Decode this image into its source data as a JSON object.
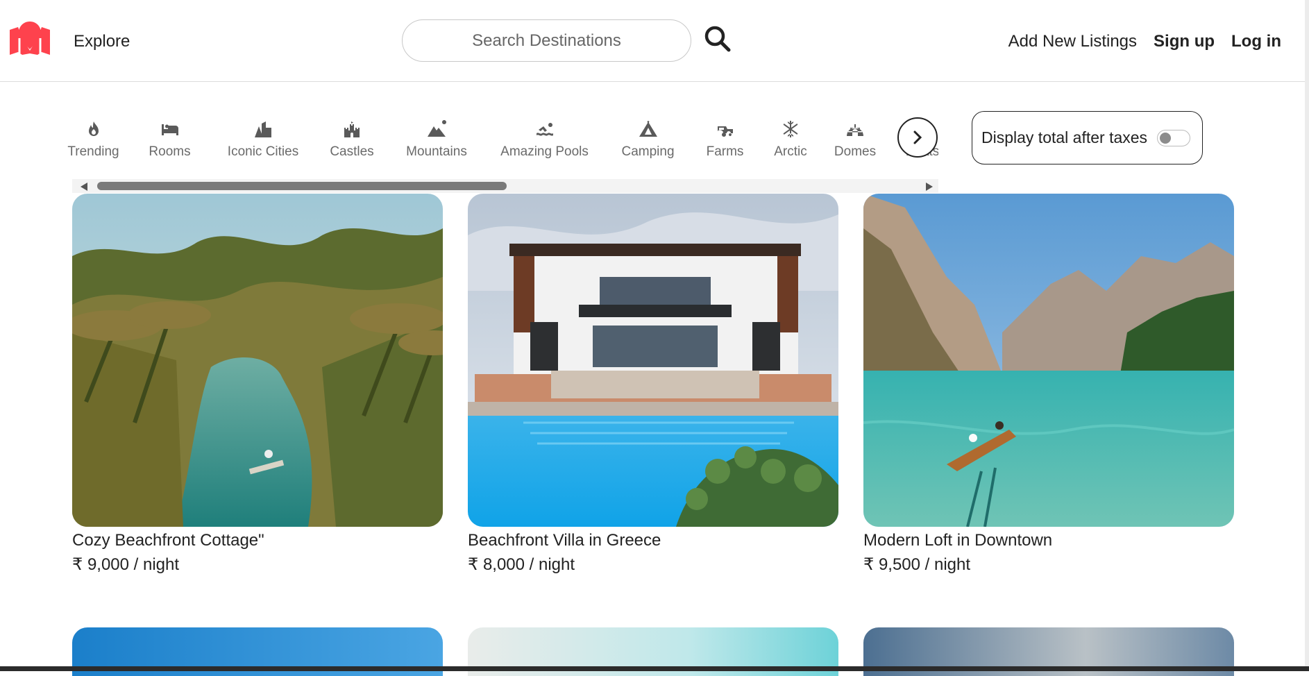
{
  "navbar": {
    "explore_label": "Explore",
    "search_placeholder": "Search Destinations",
    "add_listing_label": "Add New Listings",
    "signup_label": "Sign up",
    "login_label": "Log in",
    "brand_color": "#fe424d"
  },
  "filters": [
    {
      "label": "Trending",
      "icon": "fire-icon"
    },
    {
      "label": "Rooms",
      "icon": "bed-icon"
    },
    {
      "label": "Iconic Cities",
      "icon": "city-icon"
    },
    {
      "label": "Castles",
      "icon": "castle-icon"
    },
    {
      "label": "Mountains",
      "icon": "mountain-icon"
    },
    {
      "label": "Amazing Pools",
      "icon": "swimmer-icon"
    },
    {
      "label": "Camping",
      "icon": "tent-icon"
    },
    {
      "label": "Farms",
      "icon": "tractor-icon"
    },
    {
      "label": "Arctic",
      "icon": "snowflake-icon"
    },
    {
      "label": "Domes",
      "icon": "igloo-icon"
    },
    {
      "label": "Boats",
      "icon": "ship-icon"
    }
  ],
  "tax_toggle": {
    "label": "Display total after taxes",
    "enabled": false
  },
  "listings": [
    {
      "title": "Cozy Beachfront Cottage\"",
      "price": "₹ 9,000 / night"
    },
    {
      "title": "Beachfront Villa in Greece",
      "price": "₹ 8,000 / night"
    },
    {
      "title": "Modern Loft in Downtown",
      "price": "₹ 9,500 / night"
    }
  ]
}
